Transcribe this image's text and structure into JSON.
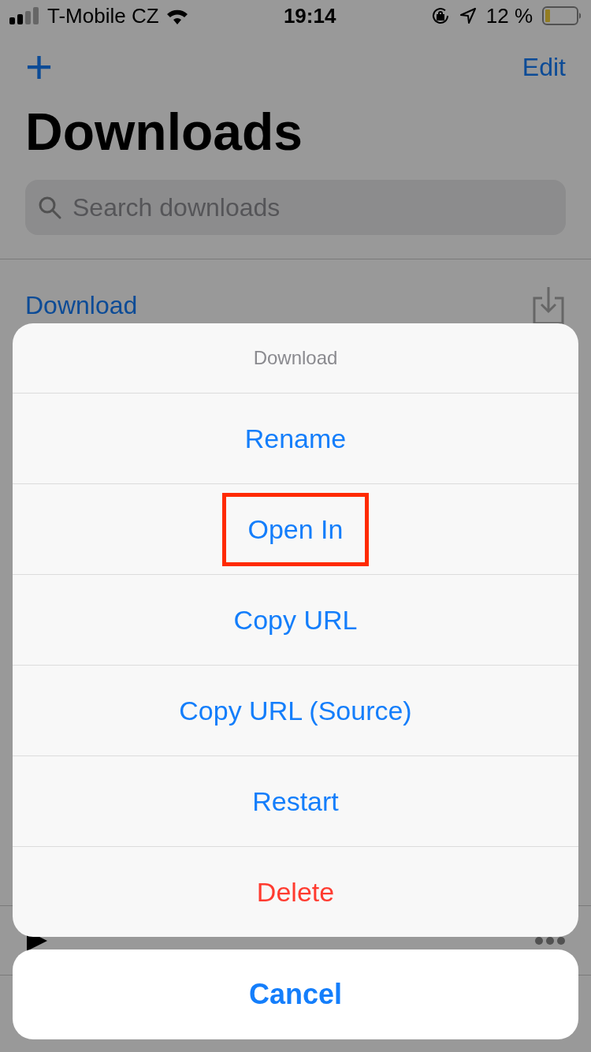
{
  "status_bar": {
    "carrier": "T-Mobile CZ",
    "time": "19:14",
    "battery": "12 %"
  },
  "nav_bar": {
    "add": "+",
    "edit": "Edit"
  },
  "title": "Downloads",
  "search": {
    "placeholder": "Search downloads"
  },
  "downloads": [
    {
      "name": "Download"
    }
  ],
  "action_sheet": {
    "title": "Download",
    "actions": [
      {
        "label": "Rename",
        "kind": "default",
        "highlighted": false
      },
      {
        "label": "Open In",
        "kind": "default",
        "highlighted": true
      },
      {
        "label": "Copy URL",
        "kind": "default",
        "highlighted": false
      },
      {
        "label": "Copy URL (Source)",
        "kind": "default",
        "highlighted": false
      },
      {
        "label": "Restart",
        "kind": "default",
        "highlighted": false
      },
      {
        "label": "Delete",
        "kind": "destructive",
        "highlighted": false
      }
    ],
    "cancel": "Cancel"
  }
}
